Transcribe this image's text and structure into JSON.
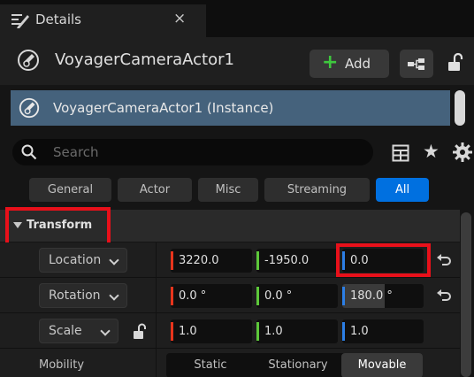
{
  "tab": {
    "title": "Details",
    "close": "×",
    "icon": "details-icon"
  },
  "actor": {
    "name": "VoyagerCameraActor1",
    "icon": "camera-actor-icon",
    "add_label": "Add"
  },
  "component": {
    "name": "VoyagerCameraActor1 (Instance)"
  },
  "search": {
    "placeholder": "Search"
  },
  "filters": [
    "General",
    "Actor",
    "Misc",
    "Streaming",
    "All"
  ],
  "active_filter": "All",
  "section": {
    "title": "Transform",
    "expanded": true
  },
  "transform": {
    "location": {
      "label": "Location",
      "x": "3220.0",
      "y": "-1950.0",
      "z": "0.0"
    },
    "rotation": {
      "label": "Rotation",
      "x": "0.0 °",
      "y": "0.0 °",
      "z": "180.0 °"
    },
    "scale": {
      "label": "Scale",
      "x": "1.0",
      "y": "1.0",
      "z": "1.0"
    }
  },
  "mobility": {
    "label": "Mobility",
    "options": [
      "Static",
      "Stationary",
      "Movable"
    ],
    "selected": "Movable"
  },
  "colors": {
    "x_axis": "#e8341c",
    "y_axis": "#5dc83a",
    "z_axis": "#2c7fe6",
    "accent": "#0070e0",
    "highlight": "#e8101a",
    "selection": "#45627c"
  },
  "highlights": [
    "transform-header",
    "location-z-field"
  ]
}
